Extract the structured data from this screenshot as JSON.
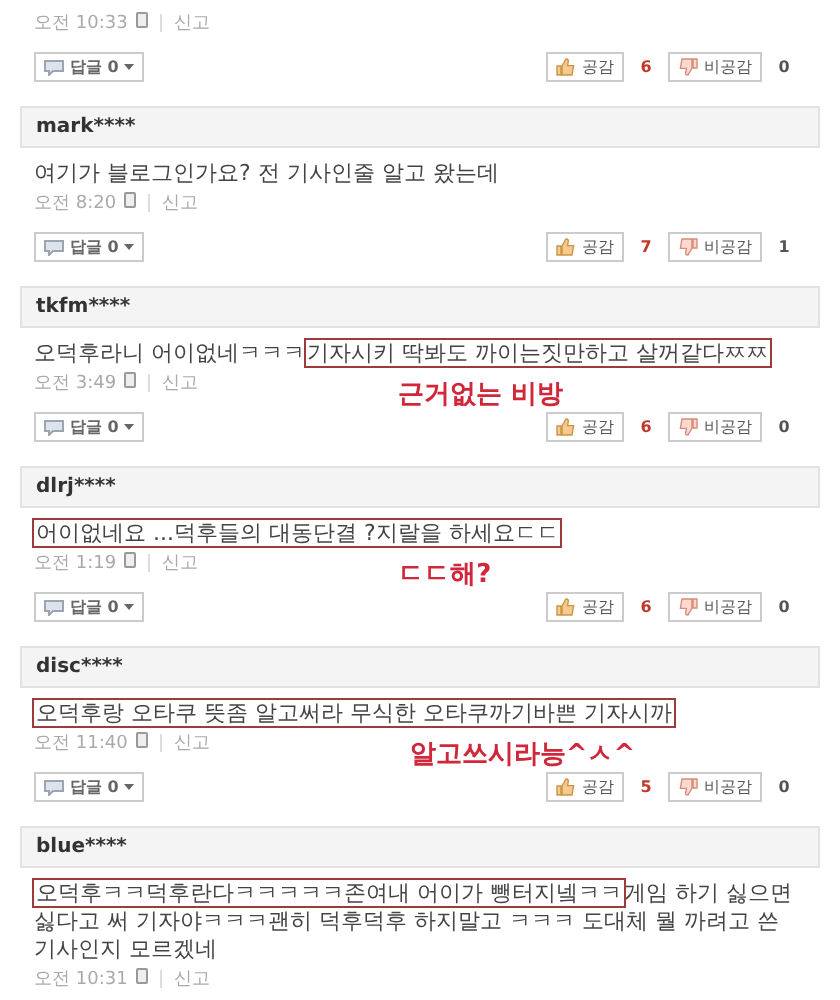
{
  "comments": [
    {
      "time": "오전 10:33",
      "report": "신고",
      "replies": "답글 0",
      "like": "공감",
      "like_count": "6",
      "dislike": "비공감",
      "dislike_count": "0"
    },
    {
      "user": "mark****",
      "segments": [
        {
          "text": "여기가 블로그인가요? 전 기사인줄 알고 왔는데",
          "highlighted": false
        }
      ],
      "time": "오전 8:20",
      "report": "신고",
      "replies": "답글 0",
      "like": "공감",
      "like_count": "7",
      "dislike": "비공감",
      "dislike_count": "1"
    },
    {
      "user": "tkfm****",
      "segments": [
        {
          "text": "오덕후라니 어이없네ㅋㅋㅋ",
          "highlighted": false
        },
        {
          "text": "기자시키 딱봐도 까이는짓만하고 살꺼같다ㅉㅉ",
          "highlighted": true
        }
      ],
      "time": "오전 3:49",
      "report": "신고",
      "annotation": "근거없는 비방",
      "replies": "답글 0",
      "like": "공감",
      "like_count": "6",
      "dislike": "비공감",
      "dislike_count": "0"
    },
    {
      "user": "dlrj****",
      "segments": [
        {
          "text": "어이없네요 ...덕후들의 대동단결 ?지랄을 하세요ㄷㄷ",
          "highlighted": true
        }
      ],
      "time": "오전 1:19",
      "report": "신고",
      "annotation": "ㄷㄷ해?",
      "replies": "답글 0",
      "like": "공감",
      "like_count": "6",
      "dislike": "비공감",
      "dislike_count": "0"
    },
    {
      "user": "disc****",
      "segments": [
        {
          "text": "오덕후랑 오타쿠 뜻좀 알고써라 무식한 오타쿠까기바쁜 기자시까",
          "highlighted": true
        }
      ],
      "time": "오전 11:40",
      "report": "신고",
      "annotation": "알고쓰시라능^ㅅ^",
      "replies": "답글 0",
      "like": "공감",
      "like_count": "5",
      "dislike": "비공감",
      "dislike_count": "0"
    },
    {
      "user": "blue****",
      "segments": [
        {
          "text": "오덕후ㅋㅋ덕후란다ㅋㅋㅋㅋㅋ존여내 어이가 뺑터지넼ㅋㅋ",
          "highlighted": true
        },
        {
          "text": "게임 하기 싫으면 싫다고 써 기자야ㅋㅋㅋ괜히 덕후덕후 하지말고 ㅋㅋㅋ 도대체 뭘 까려고 쓴 기사인지 모르겠네",
          "highlighted": false
        }
      ],
      "time": "오전 10:31",
      "report": "신고"
    }
  ]
}
